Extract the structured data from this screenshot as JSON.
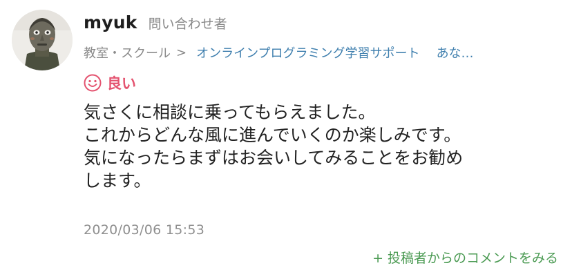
{
  "user": {
    "name": "myuk",
    "role": "問い合わせ者"
  },
  "breadcrumb": {
    "category": "教室・スクール",
    "separator": ">",
    "service": "オンラインプログラミング学習サポート",
    "extra": "あな…"
  },
  "rating": {
    "icon": "smile-icon",
    "label": "良い",
    "color": "#e4536f"
  },
  "review": {
    "lines": [
      "気さくに相談に乗ってもらえました。",
      "これからどんな風に進んでいくのか楽しみです。",
      "気になったらまずはお会いしてみることをお勧め",
      "します。"
    ]
  },
  "date": "2020/03/06 15:53",
  "comments_link": {
    "plus": "+",
    "label": "投稿者からのコメントをみる",
    "color": "#4a9a52"
  }
}
